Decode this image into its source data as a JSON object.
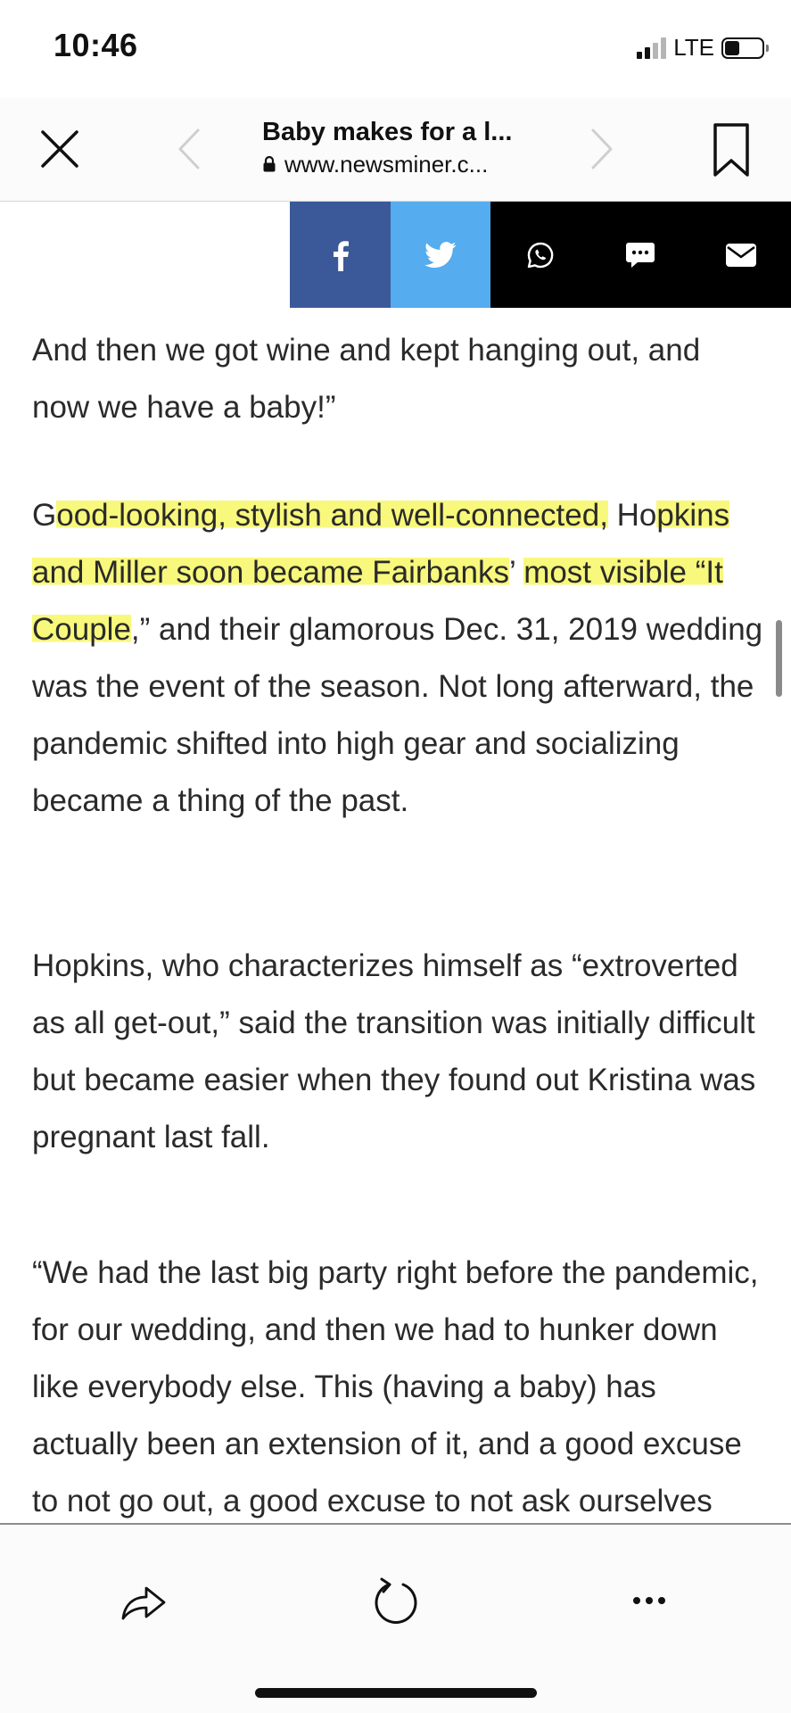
{
  "status_bar": {
    "time": "10:46",
    "network": "LTE",
    "signal_bars_active": 2,
    "signal_bars_total": 4,
    "battery_level": 0.4
  },
  "browser": {
    "title": "Baby makes for a l...",
    "url": "www.newsminer.c...",
    "close_icon": "close-icon",
    "back_icon": "chevron-left-icon",
    "forward_icon": "chevron-right-icon",
    "bookmark_icon": "bookmark-icon",
    "lock_icon": "lock-icon"
  },
  "share_bar": {
    "buttons": [
      {
        "name": "facebook",
        "icon": "facebook-icon",
        "color": "#3b5998"
      },
      {
        "name": "twitter",
        "icon": "twitter-icon",
        "color": "#55acee"
      },
      {
        "name": "whatsapp",
        "icon": "whatsapp-icon",
        "color": "#000000"
      },
      {
        "name": "sms",
        "icon": "sms-icon",
        "color": "#000000"
      },
      {
        "name": "email",
        "icon": "email-icon",
        "color": "#000000"
      }
    ]
  },
  "article": {
    "paragraph1": "And then we got wine and kept hanging out, and now we have a baby!”",
    "paragraph2": {
      "lead_letter_1": "G",
      "highlight_1": "ood-looking, stylish and well-connected,",
      "lead_letter_2": " Ho",
      "highlight_2": "pkins and Miller soon became Fairbanks",
      "after_highlight_2": "’ ",
      "highlight_3": "most visible “It Couple",
      "rest": ",” and their glamorous Dec. 31, 2019 wedding was the event of the season. Not long afterward, the pandemic shifted into high gear and socializing became a thing of the past."
    },
    "paragraph3": "Hopkins, who characterizes himself as “extroverted as all get-out,” said the transition was initially difficult but became easier when they found out Kristina was pregnant last fall.",
    "paragraph4": "“We had the last big party right before the pandemic, for our wedding, and then we had to hunker down like everybody else. This (having a baby) has actually been an extension of it, and a good excuse to not go out, a good excuse to not ask ourselves ‘What are we going to do",
    "highlight_color": "#f6f650"
  },
  "toolbar": {
    "share_icon": "share-icon",
    "reload_icon": "reload-icon",
    "more_icon": "more-icon"
  }
}
